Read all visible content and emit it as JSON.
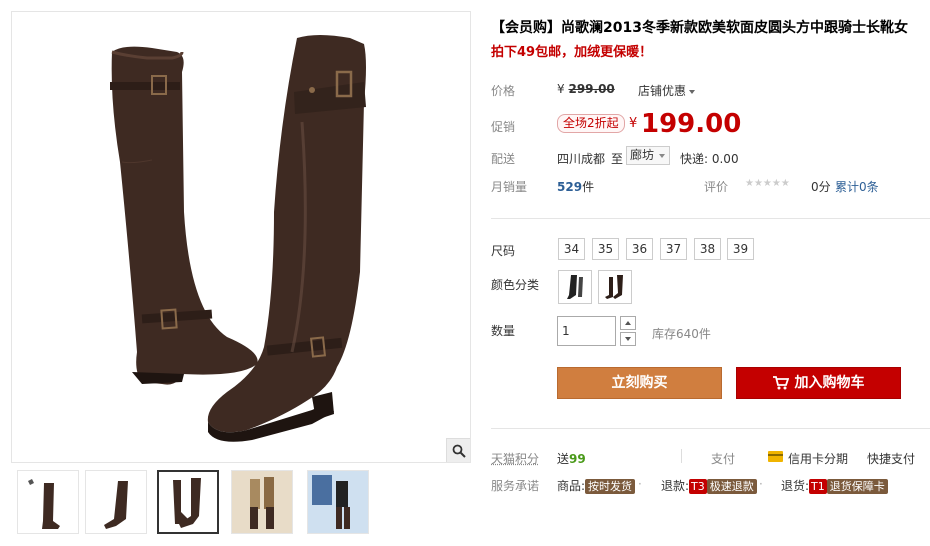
{
  "product": {
    "title": "【会员购】尚歌澜2013冬季新款欧美软面皮圆头方中跟骑士长靴女",
    "promo": "拍下49包邮，加绒更保暖！"
  },
  "price": {
    "label": "价格",
    "currency": "¥",
    "original": "299.00",
    "store_discount": "店铺优惠"
  },
  "promotion": {
    "label": "促销",
    "tag": "全场2折起",
    "currency": "¥",
    "price": "199.00"
  },
  "shipping": {
    "label": "配送",
    "from": "四川成都",
    "to_label": "至",
    "to_city": "廊坊",
    "fee_label": "快递: 0.00"
  },
  "sales": {
    "label": "月销量",
    "count": "529",
    "unit": "件",
    "rating_label": "评价",
    "stars": "★★★★★",
    "score": "0分",
    "reviews": "累计0条"
  },
  "size": {
    "label": "尺码",
    "options": [
      "34",
      "35",
      "36",
      "37",
      "38",
      "39"
    ]
  },
  "color": {
    "label": "颜色分类"
  },
  "quantity": {
    "label": "数量",
    "value": "1",
    "stock": "库存640件"
  },
  "actions": {
    "buy_now": "立刻购买",
    "add_to_cart": "加入购物车"
  },
  "points": {
    "label": "天猫积分",
    "send": "送",
    "amount": "99",
    "pay_label": "支付",
    "credit": "信用卡分期",
    "quick_pay": "快捷支付"
  },
  "service": {
    "label": "服务承诺",
    "goods_label": "商品:",
    "goods_tag": "按时发货",
    "refund_label": "退款:",
    "refund_code": "T3",
    "refund_tag": "极速退款",
    "return_label": "退货:",
    "return_code": "T1",
    "return_tag": "退货保障卡"
  },
  "colors": {
    "price_red": "#c40000",
    "buy_orange": "#d07e3f",
    "boot_brown": "#3e2a22"
  }
}
